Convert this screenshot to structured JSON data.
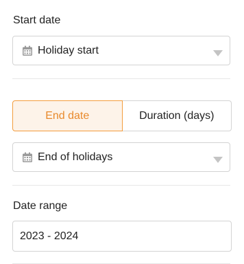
{
  "start_date": {
    "label": "Start date",
    "value": "Holiday start"
  },
  "end_mode": {
    "options": [
      "End date",
      "Duration (days)"
    ],
    "selected": "End date"
  },
  "end_date": {
    "value": "End of holidays"
  },
  "date_range": {
    "label": "Date range",
    "value": "2023 - 2024"
  },
  "colors": {
    "accent": "#e8892b",
    "accent_bg": "#fdf3e9",
    "border": "#d3d3d3",
    "icon": "#9a9a9a"
  }
}
